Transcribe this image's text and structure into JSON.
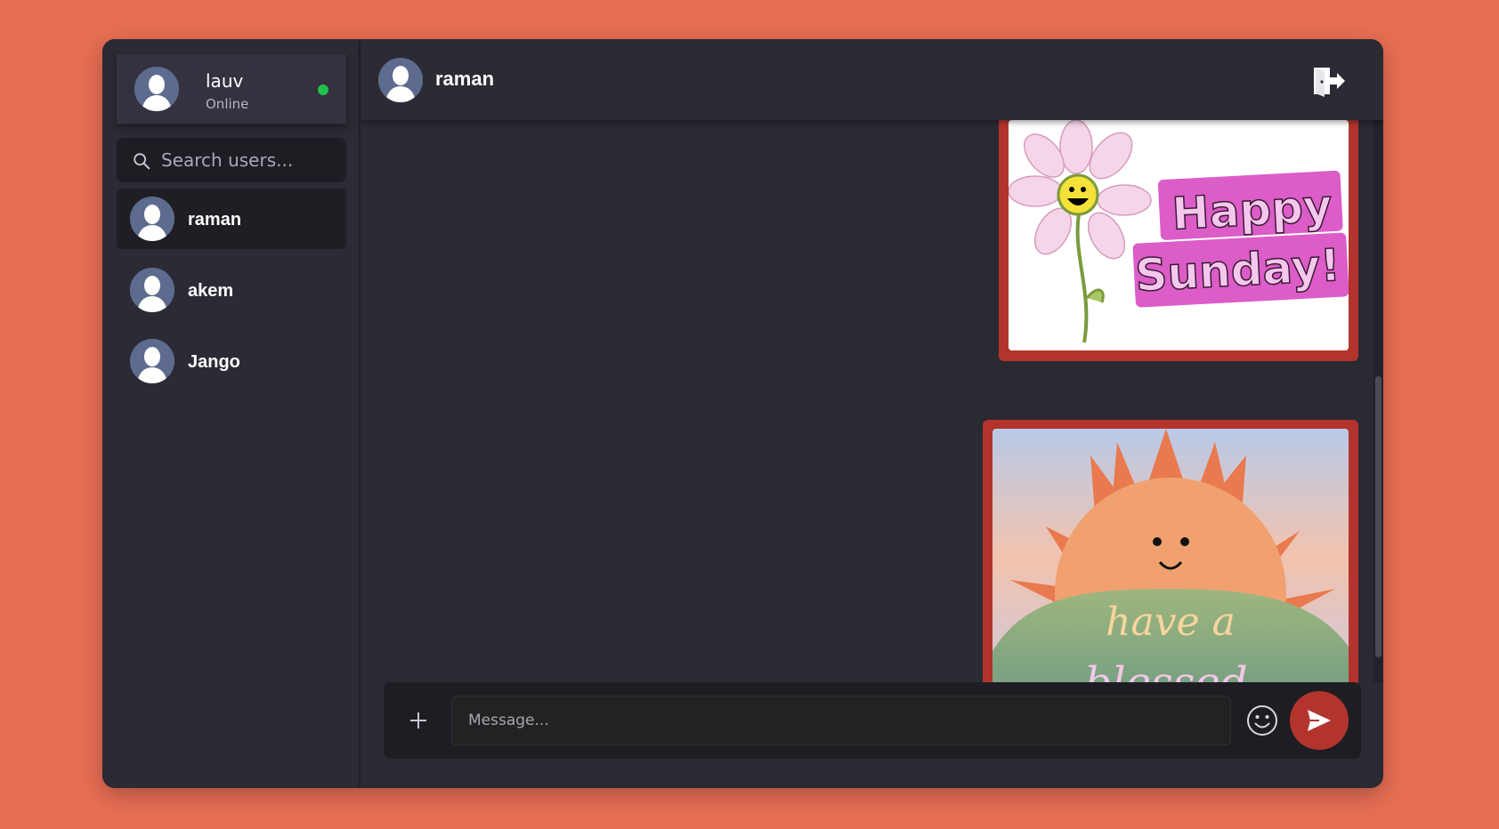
{
  "current_user": {
    "name": "lauv",
    "status": "Online",
    "status_color": "#1fc24c"
  },
  "search": {
    "placeholder": "Search users..."
  },
  "users": [
    {
      "name": "raman",
      "active": true
    },
    {
      "name": "akem",
      "active": false
    },
    {
      "name": "Jango",
      "active": false
    }
  ],
  "chat": {
    "title": "raman",
    "messages": [
      {
        "type": "image",
        "caption_lines": [
          "Happy",
          "Sunday!"
        ]
      },
      {
        "type": "image",
        "caption_lines": [
          "have a",
          "blessed"
        ]
      }
    ]
  },
  "composer": {
    "placeholder": "Message..."
  },
  "icons": {
    "search": "search-icon",
    "logout": "logout-icon",
    "attach": "plus-icon",
    "emoji": "smiley-icon",
    "send": "send-icon"
  },
  "colors": {
    "accent": "#b3342c",
    "background": "#e66e53",
    "panel": "#2a2a33"
  }
}
